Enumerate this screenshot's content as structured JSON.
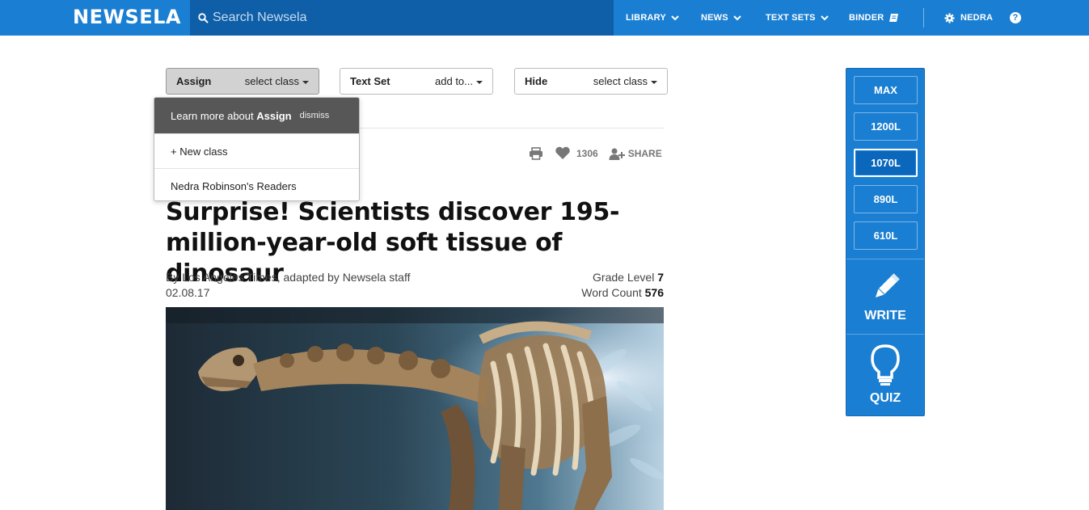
{
  "header": {
    "logo": "NEWSELA",
    "search_placeholder": "Search Newsela",
    "nav": [
      "LIBRARY",
      "NEWS",
      "TEXT SETS",
      "BINDER"
    ],
    "user": "NEDRA",
    "help": "?"
  },
  "toolbar": {
    "assign_label": "Assign",
    "assign_value": "select class",
    "textset_label": "Text Set",
    "textset_value": "add to...",
    "hide_label": "Hide",
    "hide_value": "select class"
  },
  "dropdown": {
    "head_prefix": "Learn more about ",
    "head_strong": "Assign",
    "dismiss": "dismiss",
    "new_class": "+ New class",
    "class_name": "Nedra Robinson's Readers"
  },
  "actions": {
    "likes": "1306",
    "share": "SHARE"
  },
  "article": {
    "title": "Surprise! Scientists discover 195-million-year-old soft tissue of dinosaur",
    "byline": "By Los Angeles Times, adapted by Newsela staff",
    "date": "02.08.17",
    "grade_label": "Grade Level",
    "grade_value": "7",
    "wordcount_label": "Word Count",
    "wordcount_value": "576"
  },
  "levels": {
    "items": [
      "MAX",
      "1200L",
      "1070L",
      "890L",
      "610L"
    ],
    "selected": "1070L",
    "write": "WRITE",
    "quiz": "QUIZ"
  },
  "colors": {
    "brand": "#1a7fd2",
    "search_bg": "#0e5ea8",
    "dropdown_head": "#575757"
  }
}
